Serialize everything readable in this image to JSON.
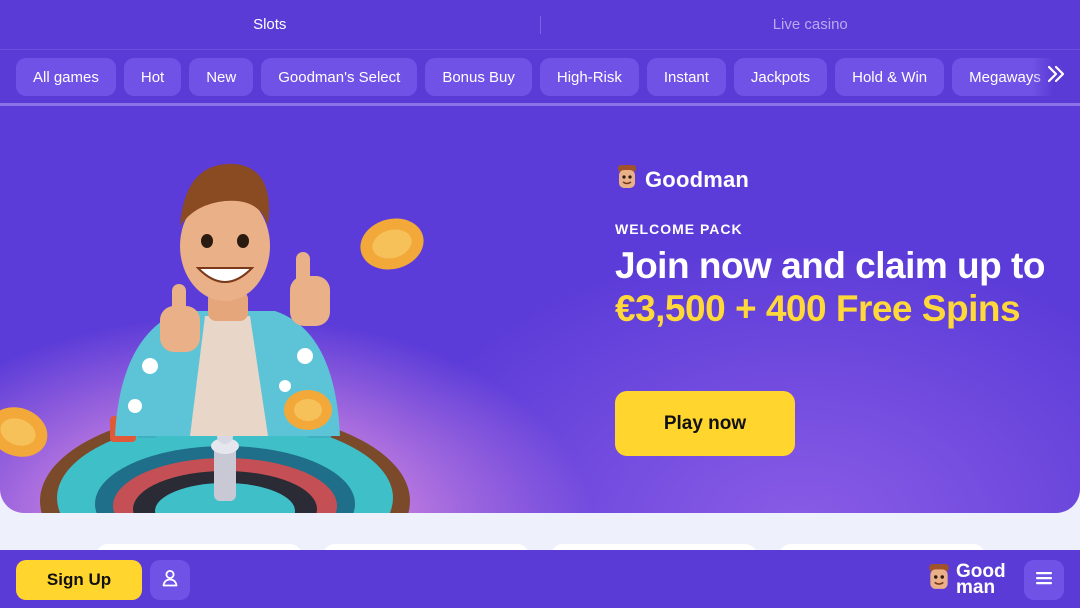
{
  "top_tabs": [
    {
      "label": "Slots",
      "active": true
    },
    {
      "label": "Live casino",
      "active": false
    }
  ],
  "categories": [
    "All games",
    "Hot",
    "New",
    "Goodman's Select",
    "Bonus Buy",
    "High-Risk",
    "Instant",
    "Jackpots",
    "Hold & Win",
    "Megaways"
  ],
  "categories_more_icon": "double-chevron-right-icon",
  "hero": {
    "brand": "Goodman",
    "eyebrow": "WELCOME PACK",
    "headline_white": "Join now and claim up to ",
    "headline_highlight": "€3,500 + 400 Free Spins",
    "cta": "Play now"
  },
  "bottom_bar": {
    "signup": "Sign Up",
    "login_icon": "user-icon",
    "logo_line1": "Good",
    "logo_line2": "man",
    "menu_icon": "hamburger-menu-icon"
  },
  "colors": {
    "primary": "#5a3bd6",
    "chip": "#7152e6",
    "accent_yellow": "#ffd52e",
    "highlight_text": "#ffd83a"
  }
}
